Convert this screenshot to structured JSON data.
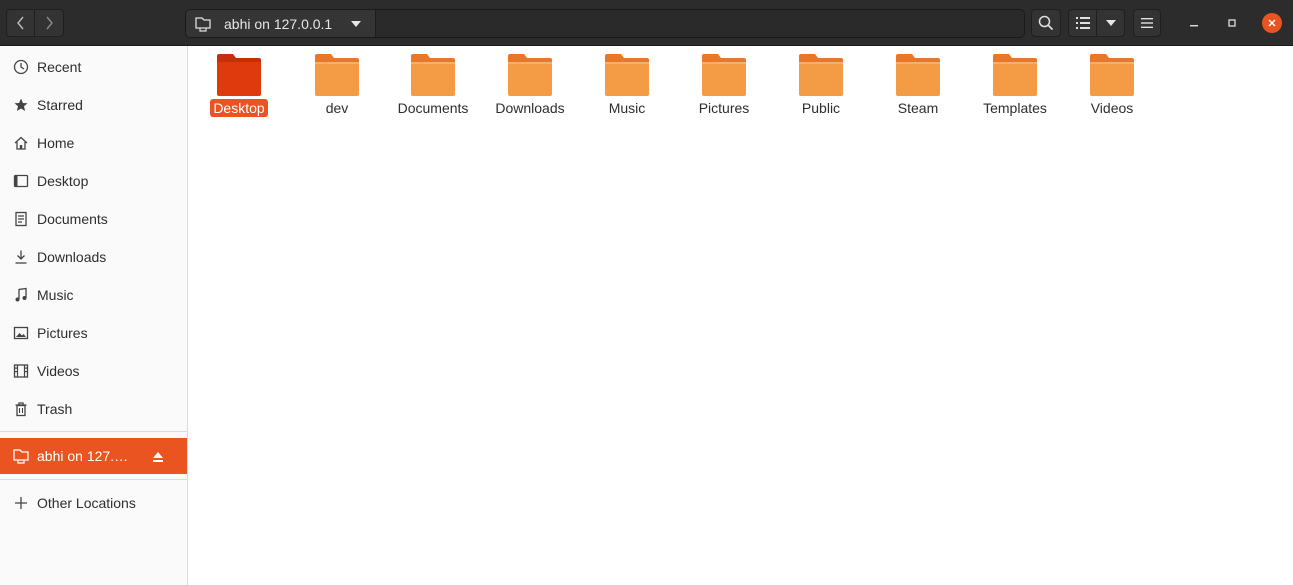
{
  "header": {
    "location_label": "abhi on 127.0.0.1",
    "icons": {
      "back": "chevron-left-icon",
      "forward": "chevron-right-icon",
      "search": "search-icon",
      "view_list": "list-view-icon",
      "view_options": "chevron-down-icon",
      "menu": "hamburger-menu-icon",
      "minimize": "minimize-icon",
      "maximize": "maximize-icon",
      "close": "close-icon"
    }
  },
  "sidebar": {
    "items": [
      {
        "label": "Recent",
        "icon": "clock-icon"
      },
      {
        "label": "Starred",
        "icon": "star-icon"
      },
      {
        "label": "Home",
        "icon": "home-icon"
      },
      {
        "label": "Desktop",
        "icon": "desktop-icon"
      },
      {
        "label": "Documents",
        "icon": "document-icon"
      },
      {
        "label": "Downloads",
        "icon": "download-icon"
      },
      {
        "label": "Music",
        "icon": "music-icon"
      },
      {
        "label": "Pictures",
        "icon": "picture-icon"
      },
      {
        "label": "Videos",
        "icon": "video-icon"
      },
      {
        "label": "Trash",
        "icon": "trash-icon"
      }
    ],
    "mount": {
      "label": "abhi on 127.…",
      "icon": "network-drive-icon",
      "eject_icon": "eject-icon"
    },
    "other": {
      "label": "Other Locations",
      "icon": "plus-icon"
    }
  },
  "colors": {
    "accent": "#e95420",
    "folder": "#f49b45",
    "folder_selected": "#df3a0e",
    "header_bg": "#2c2c2c"
  },
  "folders": [
    {
      "name": "Desktop",
      "selected": true
    },
    {
      "name": "dev",
      "selected": false
    },
    {
      "name": "Documents",
      "selected": false
    },
    {
      "name": "Downloads",
      "selected": false
    },
    {
      "name": "Music",
      "selected": false
    },
    {
      "name": "Pictures",
      "selected": false
    },
    {
      "name": "Public",
      "selected": false
    },
    {
      "name": "Steam",
      "selected": false
    },
    {
      "name": "Templates",
      "selected": false
    },
    {
      "name": "Videos",
      "selected": false
    }
  ]
}
